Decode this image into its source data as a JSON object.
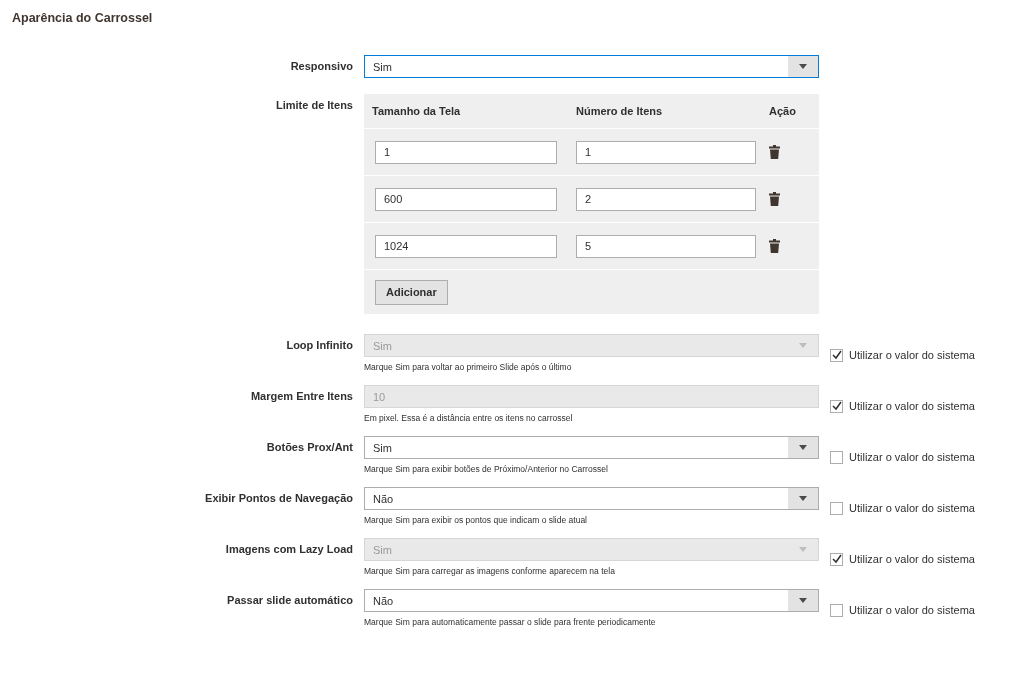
{
  "section_title": "Aparência do Carrossel",
  "responsive": {
    "label": "Responsivo",
    "value": "Sim",
    "focused": true
  },
  "item_limits": {
    "label": "Limite de Itens",
    "columns": [
      "Tamanho da Tela",
      "Número de Itens",
      "Ação"
    ],
    "rows": [
      {
        "screen_size": "1",
        "item_count": "1"
      },
      {
        "screen_size": "600",
        "item_count": "2"
      },
      {
        "screen_size": "1024",
        "item_count": "5"
      }
    ],
    "add_button": "Adicionar"
  },
  "settings": [
    {
      "kind": "select",
      "label": "Loop Infinito",
      "value": "Sim",
      "disabled": true,
      "hint": "Marque Sim para voltar ao primeiro Slide após o último",
      "use_system_value": {
        "label": "Utilizar o valor do sistema",
        "checked": true
      }
    },
    {
      "kind": "text",
      "label": "Margem Entre Itens",
      "value": "10",
      "disabled": true,
      "hint": "Em pixel. Essa é a distância entre os itens no carrossel",
      "use_system_value": {
        "label": "Utilizar o valor do sistema",
        "checked": true
      }
    },
    {
      "kind": "select",
      "label": "Botões Prox/Ant",
      "value": "Sim",
      "disabled": false,
      "hint": "Marque Sim para exibir botões de Próximo/Anterior no Carrossel",
      "use_system_value": {
        "label": "Utilizar o valor do sistema",
        "checked": false
      }
    },
    {
      "kind": "select",
      "label": "Exibir Pontos de Navegação",
      "value": "Não",
      "disabled": false,
      "hint": "Marque Sim para exibir os pontos que indicam o slide atual",
      "use_system_value": {
        "label": "Utilizar o valor do sistema",
        "checked": false
      }
    },
    {
      "kind": "select",
      "label": "Imagens com Lazy Load",
      "value": "Sim",
      "disabled": true,
      "hint": "Marque Sim para carregar as imagens conforme aparecem na tela",
      "use_system_value": {
        "label": "Utilizar o valor do sistema",
        "checked": true
      }
    },
    {
      "kind": "select",
      "label": "Passar slide automático",
      "value": "Não",
      "disabled": false,
      "hint": "Marque Sim para automaticamente passar o slide para frente periodicamente",
      "use_system_value": {
        "label": "Utilizar o valor do sistema",
        "checked": false
      }
    }
  ]
}
